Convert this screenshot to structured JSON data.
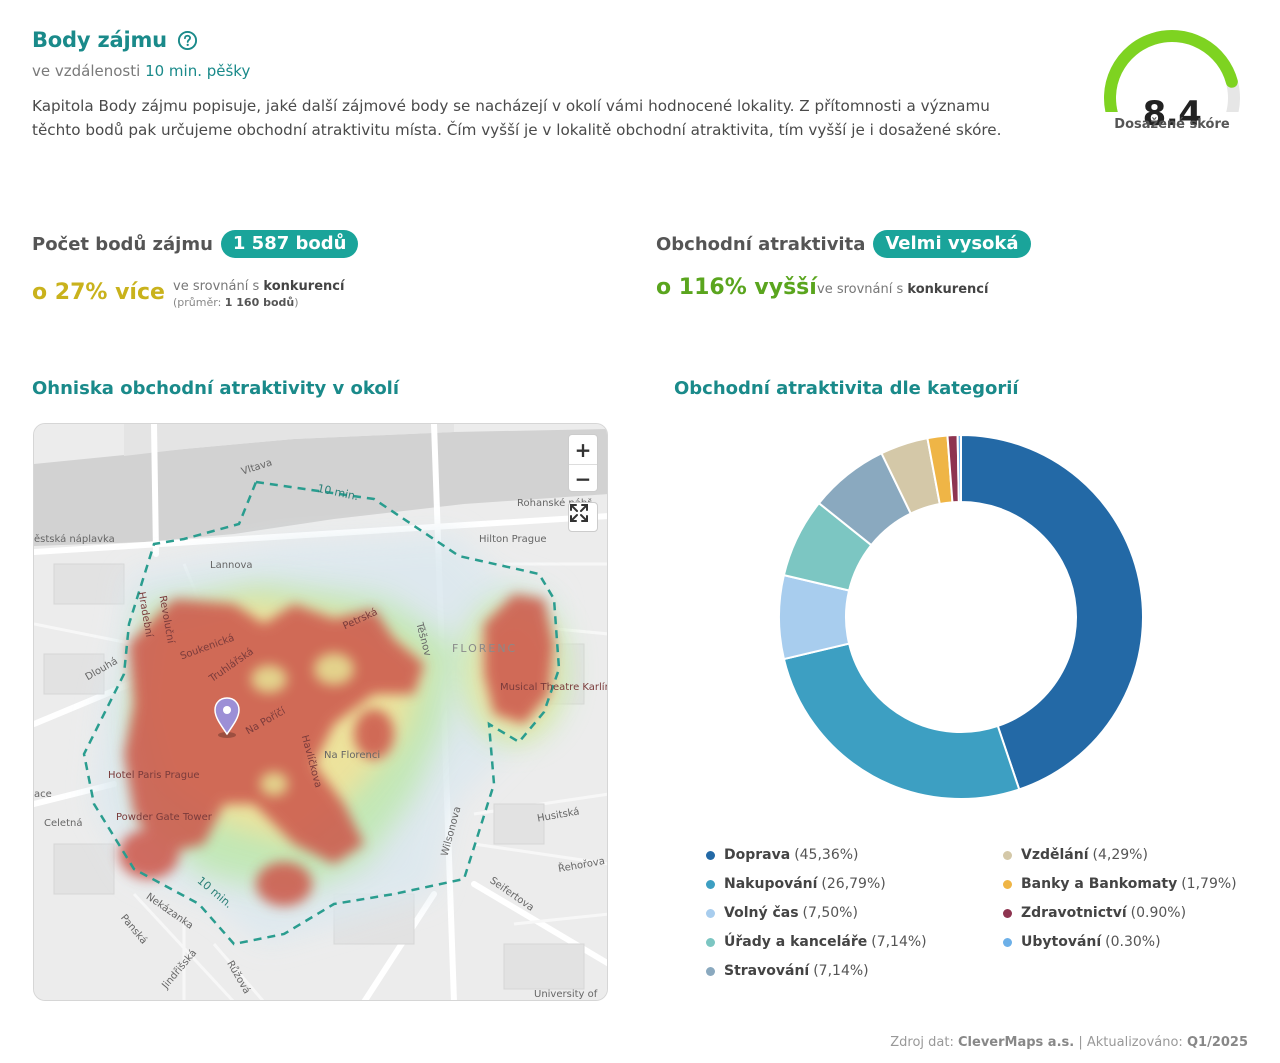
{
  "header": {
    "title": "Body zájmu",
    "subtitle_prefix": "ve vzdálenosti",
    "subtitle_highlight": "10 min. pěšky",
    "description": "Kapitola Body zájmu popisuje, jaké další zájmové body se nacházejí v okolí vámi hodnocené lokality. Z přítomnosti a významu těchto bodů pak určujeme obchodní atraktivitu místa. Čím vyšší je v lokalitě obchodní atraktivita, tím vyšší je i dosažené skóre."
  },
  "score": {
    "value": "8.4",
    "label": "Dosažené skóre",
    "fraction": 0.84
  },
  "metrics": {
    "poi": {
      "label": "Počet bodů zájmu",
      "badge": "1 587 bodů",
      "delta": "o 27% více",
      "compare_prefix": "ve srovnání s",
      "compare_bold": "konkurencí",
      "avg_prefix": "(průměr:",
      "avg_value": "1 160 bodů",
      "avg_suffix": ")"
    },
    "attractivity": {
      "label": "Obchodní atraktivita",
      "badge": "Velmi vysoká",
      "delta": "o 116% vyšší",
      "compare_prefix": "ve srovnání s",
      "compare_bold": "konkurencí"
    }
  },
  "map_section": {
    "title": "Ohniska obchodní atraktivity v okolí",
    "zoom_in": "+",
    "zoom_out": "−",
    "labels": {
      "vltava": "Vltava",
      "isochrone_top": "10 min.",
      "isochrone_bottom": "10 min.",
      "rohanske": "Rohanské nábř.",
      "naplavka": "ěstská náplavka",
      "hilton": "Hilton Prague",
      "lannova": "Lannova",
      "revolucni": "Revoluční",
      "hradebni": "Hradební",
      "soukenicka": "Soukenická",
      "truhlarska": "Truhlářská",
      "petrska": "Petrská",
      "tesnov": "Těšnov",
      "florenc": "FLORENC",
      "musical": "Musical Theatre Karlín",
      "dlouha": "Dlouhá",
      "na_porici": "Na Poříčí",
      "havlickova": "Havlíčkova",
      "na_florenci": "Na Florenci",
      "hotel_paris": "Hotel Paris Prague",
      "ace": "ace",
      "celetna": "Celetná",
      "powder_gate": "Powder Gate Tower",
      "wilsonova": "Wilsonova",
      "husitska": "Husitská",
      "rehorova": "Řehořova",
      "seifertova": "Seifertova",
      "nekazanka": "Nekázanka",
      "panska": "Panská",
      "jindrisska": "Jindřišská",
      "ruzova": "Růžová",
      "university": "University of"
    }
  },
  "categories_section": {
    "title": "Obchodní atraktivita dle kategorií"
  },
  "chart_data": {
    "type": "pie",
    "donut": true,
    "slices": [
      {
        "name": "Doprava",
        "label": "(45,36%)",
        "value": 45.36,
        "color": "#2369a6"
      },
      {
        "name": "Nakupování",
        "label": "(26,79%)",
        "value": 26.79,
        "color": "#3d9fc2"
      },
      {
        "name": "Volný čas",
        "label": "(7,50%)",
        "value": 7.5,
        "color": "#a8cdee"
      },
      {
        "name": "Úřady a kanceláře",
        "label": "(7,14%)",
        "value": 7.14,
        "color": "#7cc6c2"
      },
      {
        "name": "Stravování",
        "label": "(7,14%)",
        "value": 7.14,
        "color": "#8aa9bf"
      },
      {
        "name": "Vzdělání",
        "label": "(4,29%)",
        "value": 4.29,
        "color": "#d4c8a8"
      },
      {
        "name": "Banky a Bankomaty",
        "label": "(1,79%)",
        "value": 1.79,
        "color": "#efb546"
      },
      {
        "name": "Zdravotnictví",
        "label": "(0.90%)",
        "value": 0.9,
        "color": "#8e3450"
      },
      {
        "name": "Ubytování",
        "label": "(0.30%)",
        "value": 0.3,
        "color": "#6db0e8"
      }
    ]
  },
  "footer": {
    "source_prefix": "Zdroj dat:",
    "source": "CleverMaps a.s.",
    "updated_prefix": "| Aktualizováno:",
    "updated": "Q1/2025"
  }
}
